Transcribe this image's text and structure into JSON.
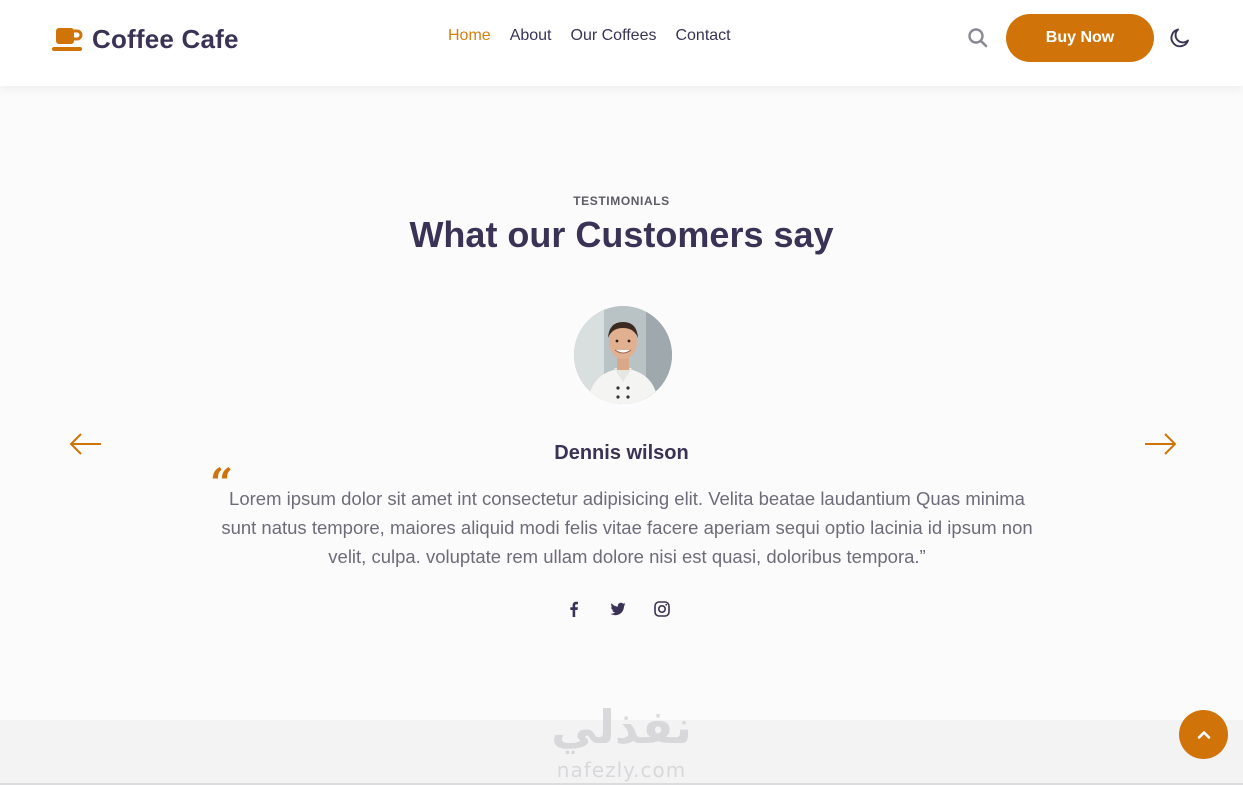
{
  "brand": {
    "name": "Coffee Cafe",
    "icon": "coffee-cup-icon",
    "accent_color": "#d0740a",
    "text_color": "#3a3355"
  },
  "nav": {
    "items": [
      {
        "label": "Home",
        "active": true
      },
      {
        "label": "About",
        "active": false
      },
      {
        "label": "Our Coffees",
        "active": false
      },
      {
        "label": "Contact",
        "active": false
      }
    ],
    "search_icon": "search-icon",
    "buy_label": "Buy Now",
    "theme_icon": "moon-icon"
  },
  "testimonials": {
    "eyebrow": "TESTIMONIALS",
    "title": "What our Customers say",
    "customer": {
      "name": "Dennis wilson",
      "quote": "Lorem ipsum dolor sit amet int consectetur adipisicing elit. Velita beatae laudantium Quas minima sunt natus tempore, maiores aliquid modi felis vitae facere aperiam sequi optio lacinia id ipsum non velit, culpa. voluptate rem ullam dolore nisi est quasi, doloribus tempora.”"
    },
    "socials": [
      "facebook-icon",
      "twitter-icon",
      "instagram-icon"
    ],
    "prev_icon": "arrow-left-icon",
    "next_icon": "arrow-right-icon"
  },
  "watermark": {
    "arabic": "نفذلي",
    "url": "nafezly.com"
  },
  "scroll_top_icon": "chevron-up-icon"
}
